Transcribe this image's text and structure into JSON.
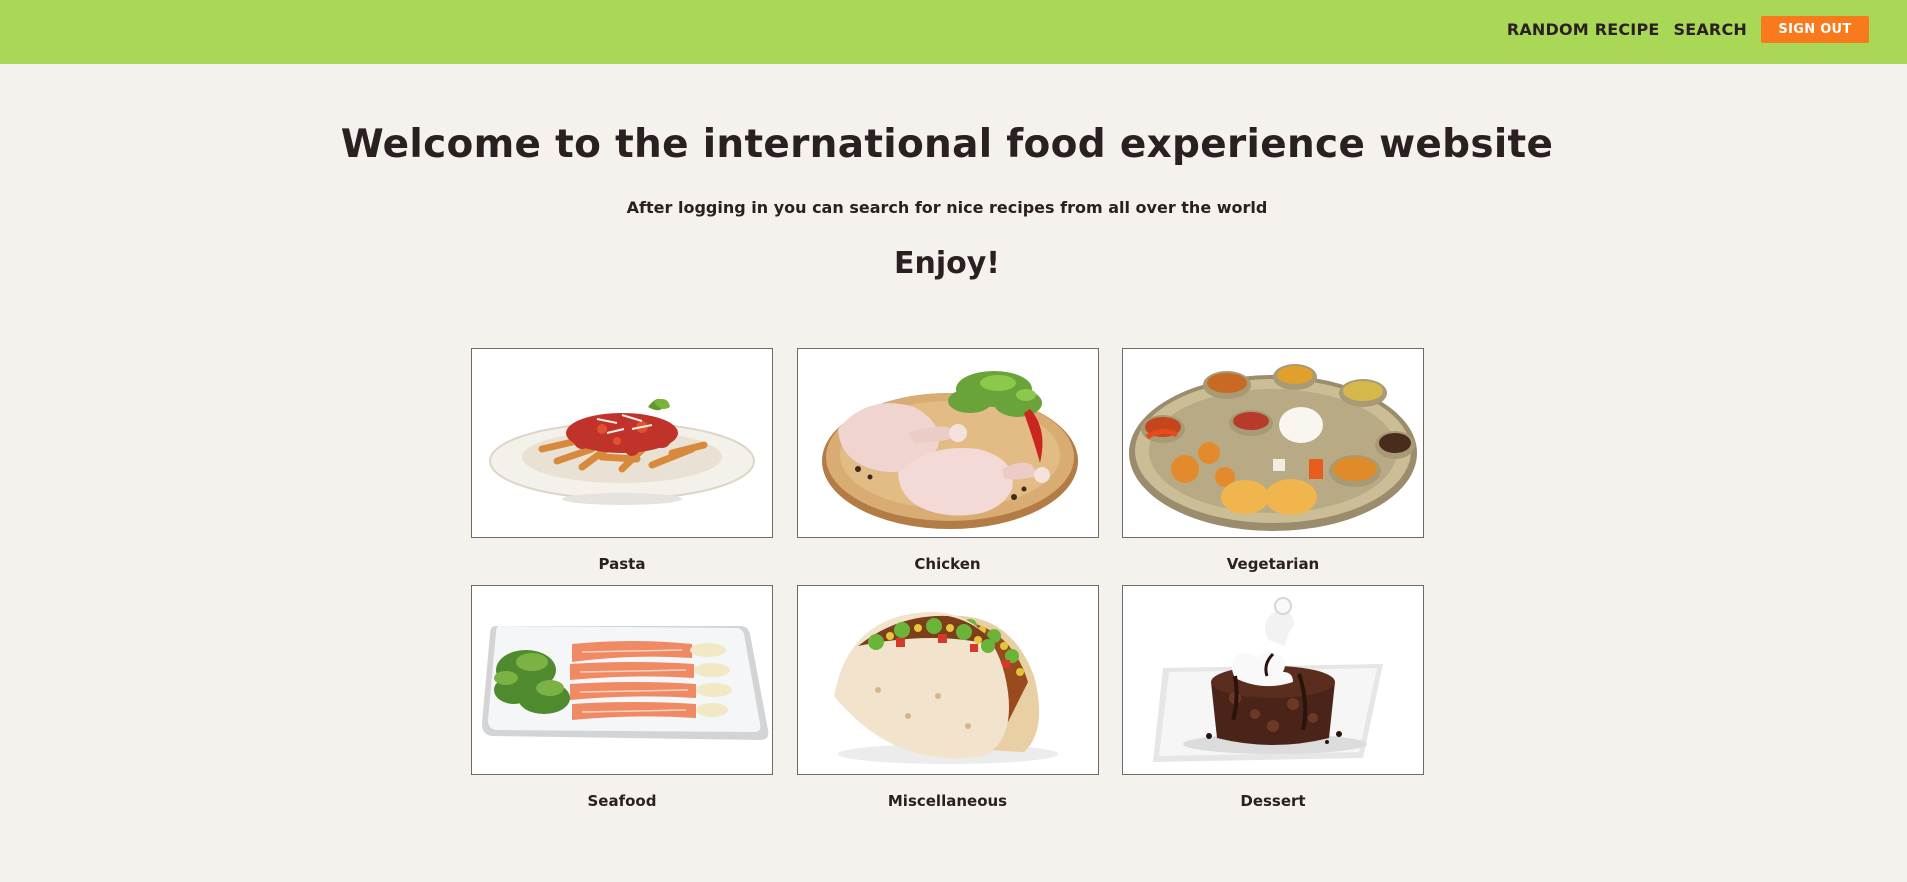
{
  "nav": {
    "random_recipe": "RANDOM RECIPE",
    "search": "SEARCH",
    "sign_out": "SIGN OUT"
  },
  "hero": {
    "title": "Welcome to the international food experience website",
    "subtitle": "After logging in you can search for nice recipes from all over the world",
    "enjoy": "Enjoy!"
  },
  "categories": [
    {
      "label": "Pasta",
      "image": "pasta-plate"
    },
    {
      "label": "Chicken",
      "image": "raw-chicken-legs"
    },
    {
      "label": "Vegetarian",
      "image": "vegetarian-thali"
    },
    {
      "label": "Seafood",
      "image": "salmon-plate"
    },
    {
      "label": "Miscellaneous",
      "image": "tacos"
    },
    {
      "label": "Dessert",
      "image": "chocolate-lava-cake"
    }
  ],
  "colors": {
    "topbar": "#a8d856",
    "sign_out": "#f97a1c",
    "background": "#f5f2ed",
    "text": "#2b2021"
  }
}
